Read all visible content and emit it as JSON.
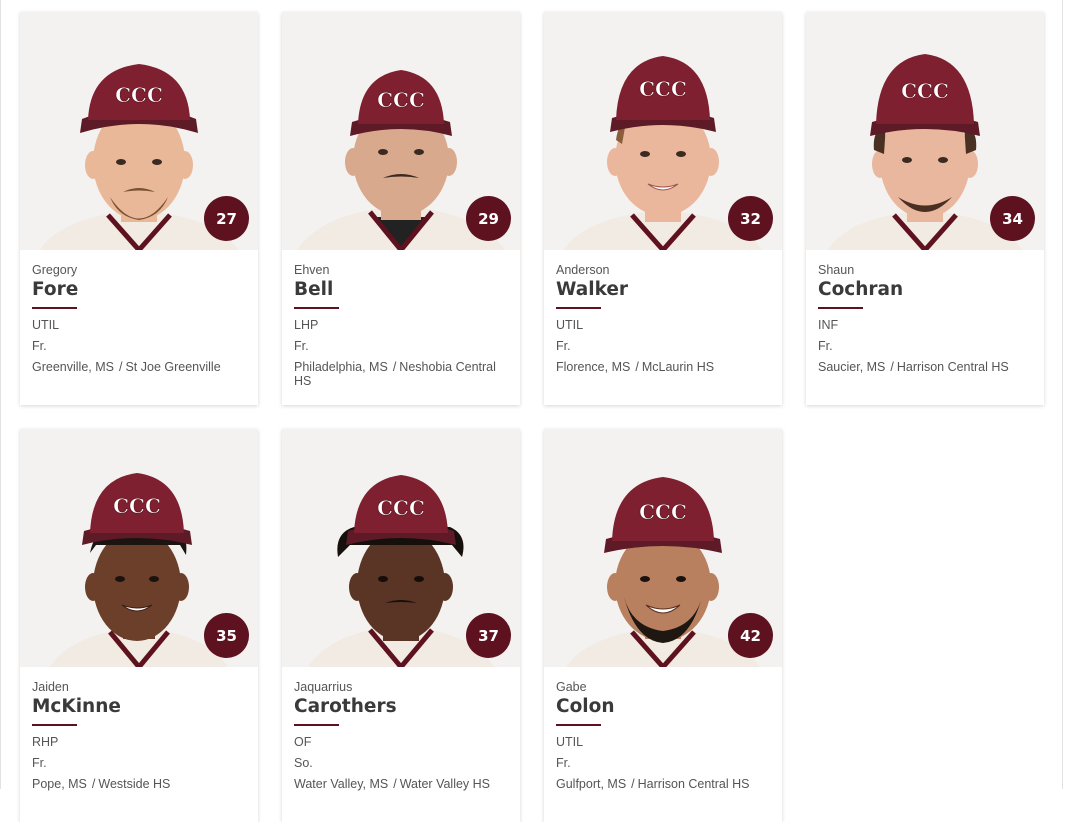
{
  "players": [
    {
      "first": "Gregory",
      "last": "Fore",
      "number": "27",
      "position": "UTIL",
      "class": "Fr.",
      "hometown": "Greenville, MS",
      "school": "St Joe Greenville",
      "skin": "#e9b899",
      "hair": "#7a5233"
    },
    {
      "first": "Ehven",
      "last": "Bell",
      "number": "29",
      "position": "LHP",
      "class": "Fr.",
      "hometown": "Philadelphia, MS",
      "school": "Neshobia Central HS",
      "skin": "#d9a98d",
      "hair": "#3b2a20"
    },
    {
      "first": "Anderson",
      "last": "Walker",
      "number": "32",
      "position": "UTIL",
      "class": "Fr.",
      "hometown": "Florence, MS",
      "school": "McLaurin HS",
      "skin": "#eab79c",
      "hair": "#8a5e3a"
    },
    {
      "first": "Shaun",
      "last": "Cochran",
      "number": "34",
      "position": "INF",
      "class": "Fr.",
      "hometown": "Saucier, MS",
      "school": "Harrison Central HS",
      "skin": "#e8b79d",
      "hair": "#4a3022"
    },
    {
      "first": "Jaiden",
      "last": "McKinne",
      "number": "35",
      "position": "RHP",
      "class": "Fr.",
      "hometown": "Pope, MS",
      "school": "Westside HS",
      "skin": "#6b3f2a",
      "hair": "#1c1410"
    },
    {
      "first": "Jaquarrius",
      "last": "Carothers",
      "number": "37",
      "position": "OF",
      "class": "So.",
      "hometown": "Water Valley, MS",
      "school": "Water Valley HS",
      "skin": "#5a3424",
      "hair": "#15100c"
    },
    {
      "first": "Gabe",
      "last": "Colon",
      "number": "42",
      "position": "UTIL",
      "class": "Fr.",
      "hometown": "Gulfport, MS",
      "school": "Harrison Central HS",
      "skin": "#b98060",
      "hair": "#1f1712"
    }
  ],
  "colors": {
    "maroon": "#5e1220",
    "cap": "#7e2030",
    "jersey": "#f1ebe3",
    "background": "#f3f2f0"
  },
  "icons": {
    "cap_logo": "ccc-cap-logo"
  }
}
